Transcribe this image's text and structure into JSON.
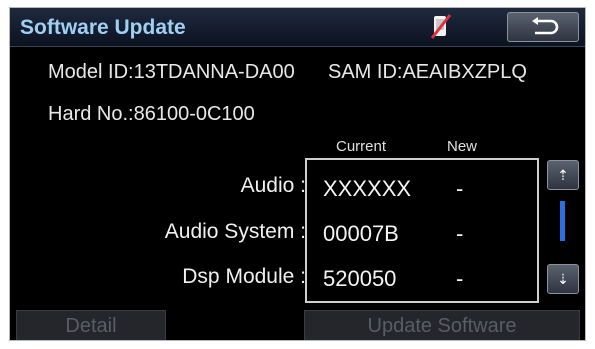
{
  "header": {
    "title": "Software Update",
    "accent_color": "#9fd0f4",
    "status_icon": "phone-disconnected-icon",
    "back_icon": "back-arrow-icon"
  },
  "info": {
    "model_id": "Model ID:13TDANNA-DA00",
    "sam_id": "SAM ID:AEAIBXZPLQ",
    "hard_no": "Hard No.:86100-0C100"
  },
  "table": {
    "headers": {
      "current": "Current",
      "new": "New"
    },
    "rows": [
      {
        "label": "Audio :",
        "current": "XXXXXX",
        "new": "-"
      },
      {
        "label": "Audio System :",
        "current": "00007B",
        "new": "-"
      },
      {
        "label": "Dsp Module :",
        "current": "520050",
        "new": "-"
      }
    ]
  },
  "scroll": {
    "up_icon": "scroll-up-icon",
    "down_icon": "scroll-down-icon",
    "up_label": "⇡",
    "down_label": "⇣"
  },
  "buttons": {
    "detail": "Detail",
    "update": "Update Software"
  }
}
